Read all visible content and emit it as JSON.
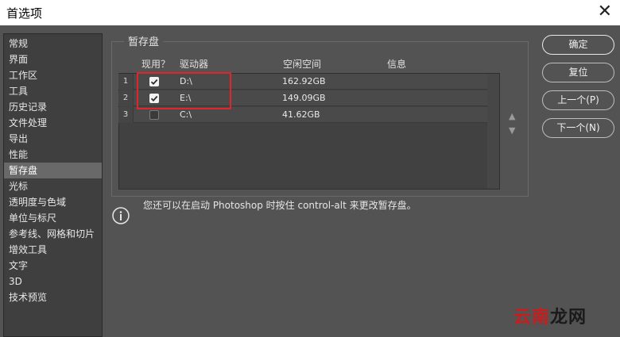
{
  "window": {
    "title": "首选项",
    "close_glyph": "✕"
  },
  "sidebar": {
    "items": [
      {
        "label": "常规"
      },
      {
        "label": "界面"
      },
      {
        "label": "工作区"
      },
      {
        "label": "工具"
      },
      {
        "label": "历史记录"
      },
      {
        "label": "文件处理"
      },
      {
        "label": "导出"
      },
      {
        "label": "性能"
      },
      {
        "label": "暂存盘",
        "selected": true
      },
      {
        "label": "光标"
      },
      {
        "label": "透明度与色域"
      },
      {
        "label": "单位与标尺"
      },
      {
        "label": "参考线、网格和切片"
      },
      {
        "label": "增效工具"
      },
      {
        "label": "文字"
      },
      {
        "label": "3D"
      },
      {
        "label": "技术预览"
      }
    ]
  },
  "scratch": {
    "title": "暂存盘",
    "columns": {
      "active": "现用？",
      "drive": "驱动器",
      "free": "空闲空间",
      "info": "信息"
    },
    "rows": [
      {
        "num": "1",
        "checked": true,
        "drive": "D:\\",
        "free": "162.92GB",
        "info": ""
      },
      {
        "num": "2",
        "checked": true,
        "drive": "E:\\",
        "free": "149.09GB",
        "info": ""
      },
      {
        "num": "3",
        "checked": false,
        "drive": "C:\\",
        "free": "41.62GB",
        "info": ""
      }
    ],
    "move_up": "▲",
    "move_down": "▼"
  },
  "info": {
    "text": "您还可以在启动 Photoshop 时按住 control-alt 来更改暂存盘。"
  },
  "buttons": {
    "ok": "确定",
    "reset": "复位",
    "prev": "上一个(P)",
    "next": "下一个(N)"
  },
  "watermark": {
    "part1": "云南",
    "part2": "龙网"
  },
  "colors": {
    "highlight": "#e0262b",
    "watermark_red": "#c81d1d"
  }
}
